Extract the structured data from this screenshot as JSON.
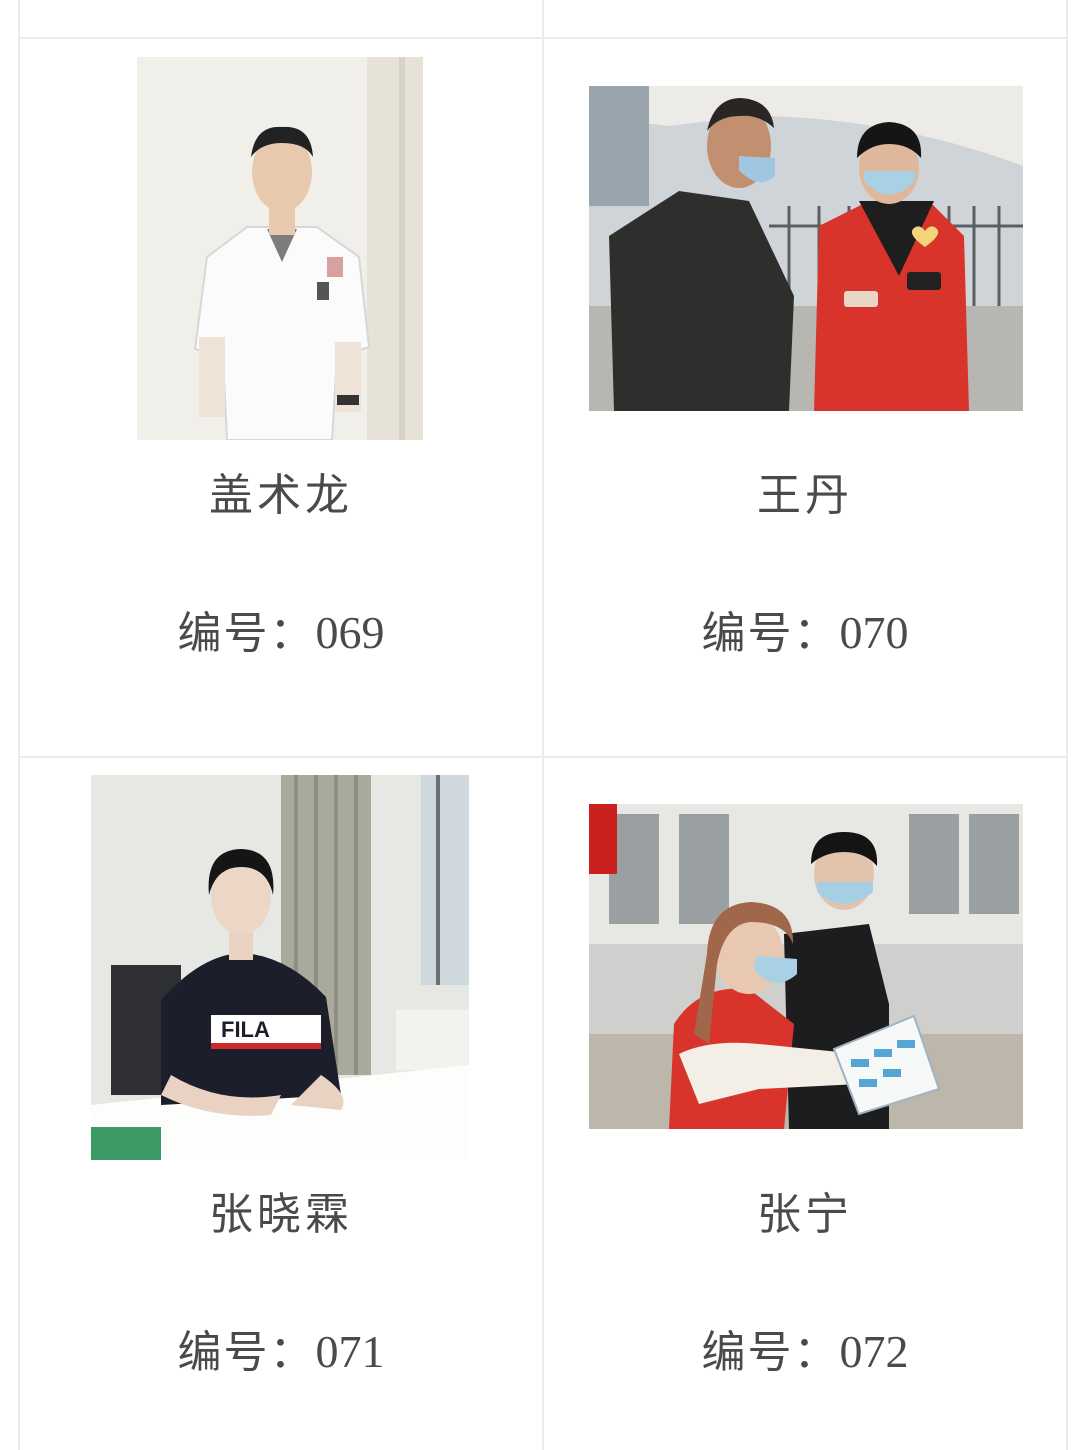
{
  "entries": [
    {
      "name": "盖术龙",
      "number_label": "编号：",
      "number_value": "069",
      "photo_icon": "person-photo-icon"
    },
    {
      "name": "王丹",
      "number_label": "编号：",
      "number_value": "070",
      "photo_icon": "volunteer-photo-icon"
    },
    {
      "name": "张晓霖",
      "number_label": "编号：",
      "number_value": "071",
      "photo_icon": "person-photo-icon"
    },
    {
      "name": "张宁",
      "number_label": "编号：",
      "number_value": "072",
      "photo_icon": "volunteer-photo-icon"
    }
  ],
  "colors": {
    "divider": "#ececec",
    "text": "#4a4a4a",
    "vest_red": "#d9342b"
  }
}
